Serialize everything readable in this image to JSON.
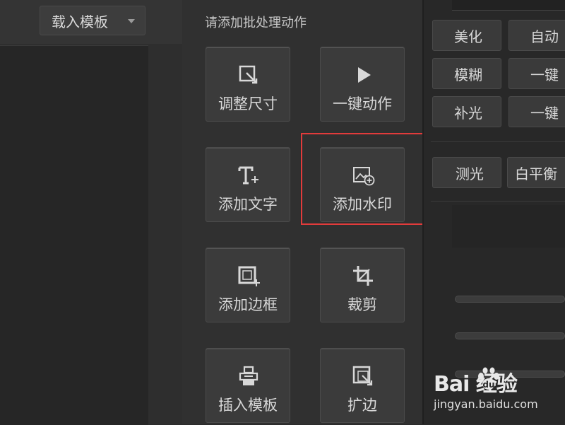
{
  "left": {
    "template_dropdown": "载入模板"
  },
  "center": {
    "title": "请添加批处理动作",
    "actions": [
      {
        "label": "调整尺寸",
        "icon": "resize-icon"
      },
      {
        "label": "一键动作",
        "icon": "play-icon"
      },
      {
        "label": "添加文字",
        "icon": "text-add-icon"
      },
      {
        "label": "添加水印",
        "icon": "watermark-image-add-icon"
      },
      {
        "label": "添加边框",
        "icon": "border-add-icon"
      },
      {
        "label": "裁剪",
        "icon": "crop-icon"
      },
      {
        "label": "插入模板",
        "icon": "template-insert-icon"
      },
      {
        "label": "扩边",
        "icon": "expand-edge-icon"
      }
    ]
  },
  "right": {
    "buttons": [
      "美化",
      "自动",
      "模糊",
      "一键",
      "补光",
      "一键",
      "测光",
      "白平衡"
    ]
  },
  "watermark": {
    "logo": "Bai  经验",
    "url": "jingyan.baidu.com"
  },
  "colors": {
    "highlight": "#e23b3b",
    "panel": "#303030"
  }
}
